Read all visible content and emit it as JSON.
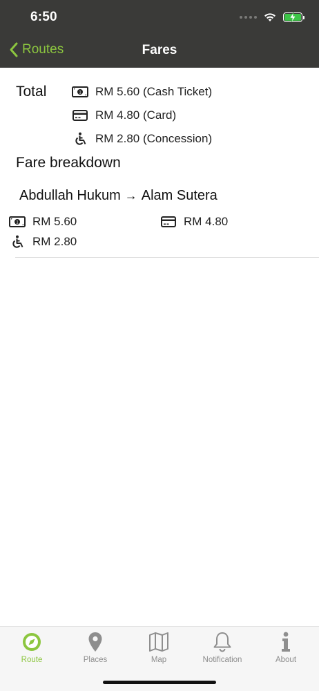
{
  "status": {
    "time": "6:50"
  },
  "nav": {
    "back_label": "Routes",
    "title": "Fares"
  },
  "total": {
    "label": "Total",
    "rows": [
      {
        "icon": "cash-icon",
        "text": "RM 5.60 (Cash Ticket)"
      },
      {
        "icon": "card-icon",
        "text": "RM 4.80 (Card)"
      },
      {
        "icon": "wheelchair-icon",
        "text": "RM 2.80 (Concession)"
      }
    ]
  },
  "breakdown": {
    "title": "Fare breakdown",
    "legs": [
      {
        "from": "Abdullah Hukum",
        "arrow": "→",
        "to": "Alam Sutera",
        "cash": "RM 5.60",
        "card": "RM 4.80",
        "concession": "RM 2.80"
      }
    ]
  },
  "tabs": [
    {
      "label": "Route",
      "icon": "route-compass-icon",
      "active": true
    },
    {
      "label": "Places",
      "icon": "map-pin-icon",
      "active": false
    },
    {
      "label": "Map",
      "icon": "folded-map-icon",
      "active": false
    },
    {
      "label": "Notification",
      "icon": "bell-icon",
      "active": false
    },
    {
      "label": "About",
      "icon": "info-icon",
      "active": false
    }
  ],
  "colors": {
    "accent": "#8cc63f",
    "navbar": "#3a3a38",
    "tab_inactive": "#8e8e8e",
    "battery": "#3cc447"
  }
}
